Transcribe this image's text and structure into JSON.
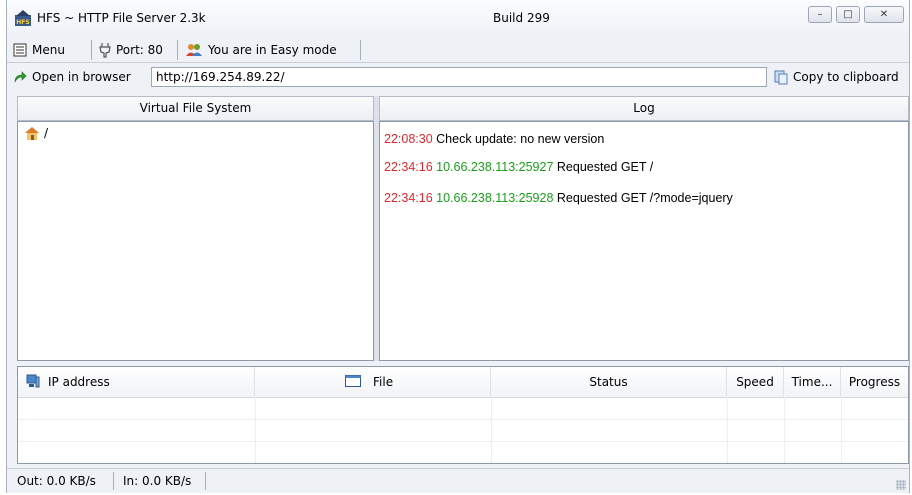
{
  "window": {
    "title": "HFS ~ HTTP File Server 2.3k",
    "build": "Build 299",
    "minimize_glyph": "–",
    "maximize_glyph": "□",
    "close_glyph": "✕"
  },
  "toolbar": {
    "menu_label": "Menu",
    "port_label": "Port: 80",
    "mode_label": "You are in Easy mode"
  },
  "urlbar": {
    "open_label": "Open in browser",
    "url": "http://169.254.89.22/",
    "copy_label": "Copy to clipboard"
  },
  "vfs": {
    "header": "Virtual File System",
    "root_label": "/"
  },
  "log": {
    "header": "Log",
    "entries": [
      {
        "time": "22:08:30",
        "address": "",
        "message": "Check update: no new version"
      },
      {
        "time": "22:34:16",
        "address": "10.66.238.113:25927",
        "message": "Requested GET /"
      },
      {
        "time": "22:34:16",
        "address": "10.66.238.113:25928",
        "message": "Requested GET /?mode=jquery"
      }
    ]
  },
  "connections": {
    "columns": [
      "IP address",
      "File",
      "Status",
      "Speed",
      "Time...",
      "Progress"
    ],
    "rows": []
  },
  "statusbar": {
    "out": "Out: 0.0 KB/s",
    "in": "In: 0.0 KB/s"
  },
  "colors": {
    "log_time": "#e3262b",
    "log_address": "#1aa01a"
  },
  "icons": {
    "app": "hfs-logo-icon",
    "menu": "menu-icon",
    "port": "plug-icon",
    "mode": "users-icon",
    "open": "green-arrow-icon",
    "copy": "clipboard-icon",
    "root": "home-icon",
    "ip_column": "computer-icon",
    "file_column": "window-icon"
  }
}
